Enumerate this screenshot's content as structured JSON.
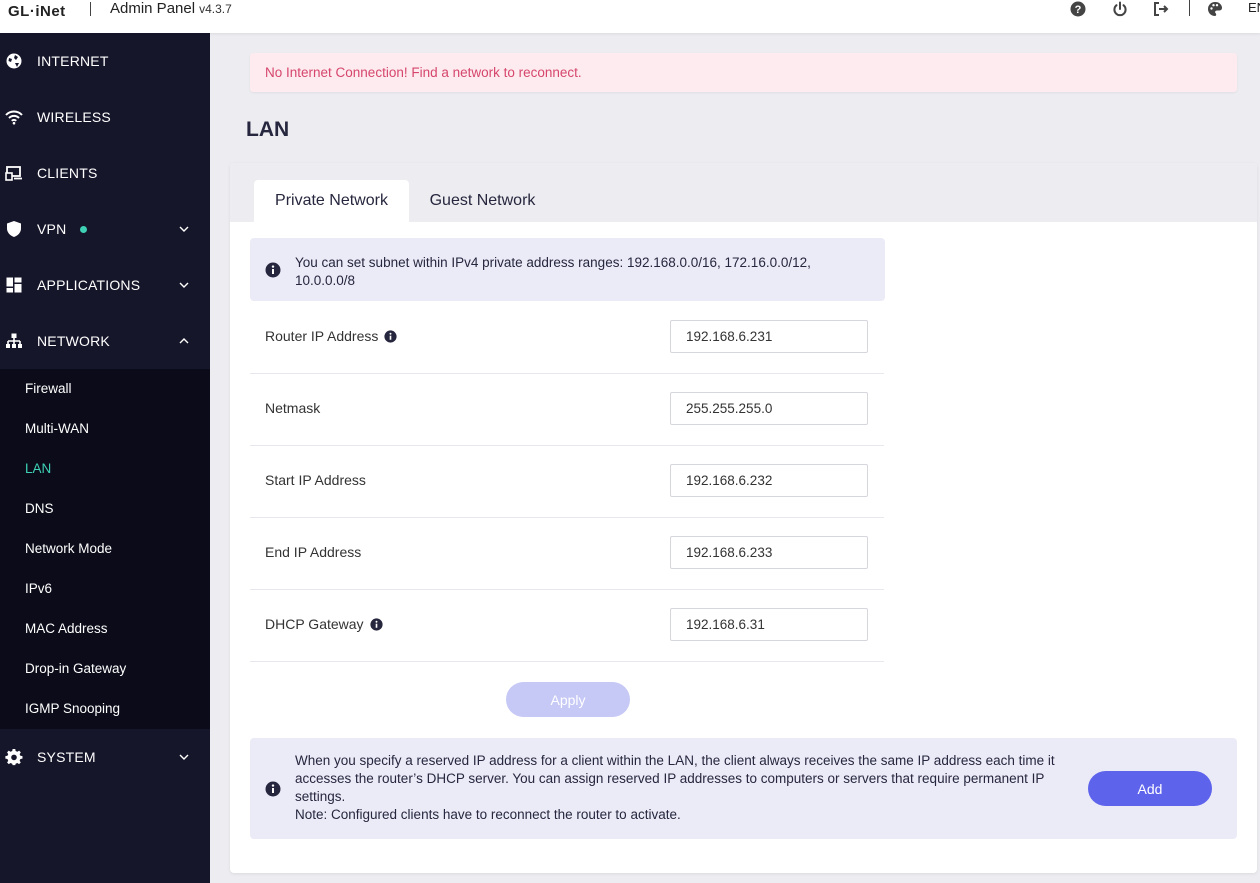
{
  "header": {
    "logo": "GL·iNet",
    "title": "Admin Panel",
    "version": "v4.3.7",
    "language": "EN",
    "icons": [
      "help-icon",
      "power-icon",
      "logout-icon",
      "theme-palette-icon"
    ]
  },
  "sidebar": {
    "items": [
      {
        "label": "INTERNET",
        "icon": "globe-icon"
      },
      {
        "label": "WIRELESS",
        "icon": "wifi-icon"
      },
      {
        "label": "CLIENTS",
        "icon": "devices-icon"
      },
      {
        "label": "VPN",
        "icon": "shield-icon",
        "status_dot": true
      },
      {
        "label": "APPLICATIONS",
        "icon": "grid-icon"
      },
      {
        "label": "NETWORK",
        "icon": "network-icon",
        "expanded": true
      },
      {
        "label": "SYSTEM",
        "icon": "gear-icon"
      }
    ],
    "network_submenu": [
      {
        "label": "Firewall"
      },
      {
        "label": "Multi-WAN"
      },
      {
        "label": "LAN",
        "active": true
      },
      {
        "label": "DNS"
      },
      {
        "label": "Network Mode"
      },
      {
        "label": "IPv6"
      },
      {
        "label": "MAC Address"
      },
      {
        "label": "Drop-in Gateway"
      },
      {
        "label": "IGMP Snooping"
      }
    ]
  },
  "alert": {
    "message": "No Internet Connection! Find a network to reconnect."
  },
  "page": {
    "title": "LAN"
  },
  "tabs": [
    {
      "label": "Private Network",
      "active": true
    },
    {
      "label": "Guest Network",
      "active": false
    }
  ],
  "subnet_info": "You can set subnet within IPv4 private address ranges: 192.168.0.0/16, 172.16.0.0/12, 10.0.0.0/8",
  "form": {
    "router_ip": {
      "label": "Router IP Address",
      "value": "192.168.6.231"
    },
    "netmask": {
      "label": "Netmask",
      "value": "255.255.255.0"
    },
    "start_ip": {
      "label": "Start IP Address",
      "value": "192.168.6.232"
    },
    "end_ip": {
      "label": "End IP Address",
      "value": "192.168.6.233"
    },
    "dhcp_gateway": {
      "label": "DHCP Gateway",
      "value": "192.168.6.31"
    },
    "apply_label": "Apply"
  },
  "reserved": {
    "line1": "When you specify a reserved IP address for a client within the LAN, the client always receives the same IP address each time it accesses the router’s DHCP server. You can assign reserved IP addresses to computers or servers that require permanent IP settings.",
    "line2": "Note: Configured clients have to reconnect the router to activate.",
    "add_label": "Add"
  },
  "colors": {
    "sidebar_bg": "#16162b",
    "submenu_bg": "#0b0b19",
    "accent_teal": "#3fd1b5",
    "primary": "#5e63ec",
    "apply_disabled": "#c6c8f5",
    "alert_bg": "#fdebef",
    "alert_text": "#d6466c"
  }
}
